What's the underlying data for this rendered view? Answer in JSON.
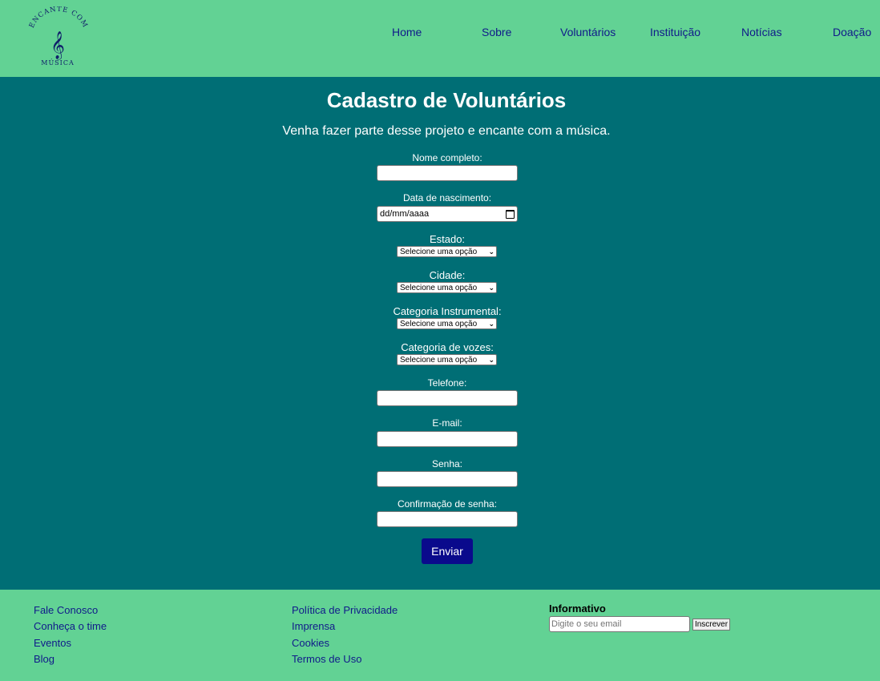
{
  "brand": {
    "logo_top_text": "ENCANTE COM",
    "logo_bottom_text": "MÚSICA",
    "logo_symbol": "𝄞"
  },
  "nav": {
    "items": [
      "Home",
      "Sobre",
      "Voluntários",
      "Instituição",
      "Notícias",
      "Doação"
    ]
  },
  "main": {
    "title": "Cadastro de Voluntários",
    "subtitle": "Venha fazer parte desse projeto e encante com a música.",
    "fields": {
      "name_label": "Nome completo:",
      "birth_label": "Data de nascimento:",
      "birth_value": "dd/mm/aaaa",
      "state_label": "Estado:",
      "state_selected": "Selecione uma opção",
      "city_label": "Cidade:",
      "city_selected": "Selecione uma opção",
      "instrument_label": "Categoria Instrumental:",
      "instrument_selected": "Selecione uma opção",
      "voice_label": "Categoria de vozes:",
      "voice_selected": "Selecione uma opção",
      "phone_label": "Telefone:",
      "email_label": "E-mail:",
      "password_label": "Senha:",
      "password_confirm_label": "Confirmação de senha:"
    },
    "submit_label": "Enviar"
  },
  "footer": {
    "col1": [
      "Fale Conosco",
      "Conheça o time",
      "Eventos",
      "Blog"
    ],
    "col2": [
      "Política de Privacidade",
      "Imprensa",
      "Cookies",
      "Termos de Uso"
    ],
    "newsletter": {
      "title": "Informativo",
      "placeholder": "Digite o seu email",
      "button_label": "Inscrever"
    }
  },
  "colors": {
    "header_bg": "#62d294",
    "main_bg": "#006e75",
    "link": "#101a8a",
    "button": "#0a0a8c"
  }
}
